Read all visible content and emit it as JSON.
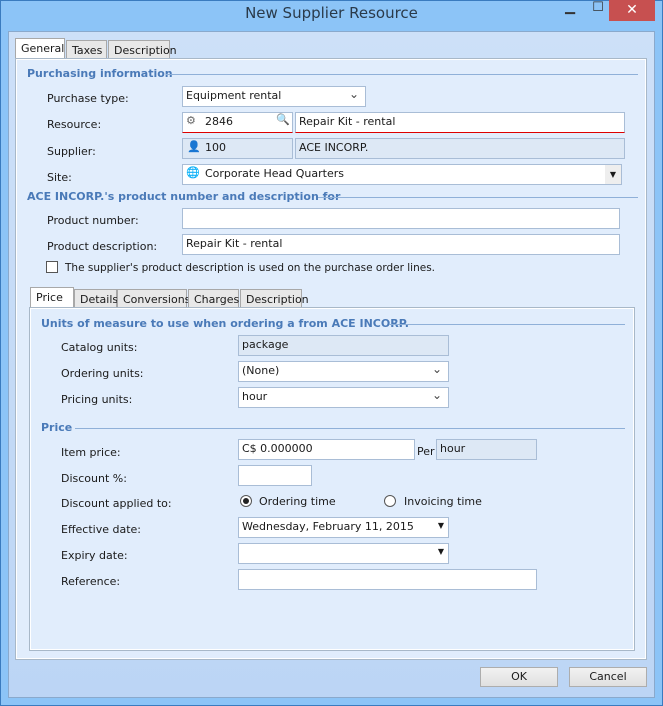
{
  "window": {
    "title": "New Supplier Resource"
  },
  "tabs": [
    "General",
    "Taxes",
    "Description"
  ],
  "purchasing": {
    "heading": "Purchasing information",
    "purchase_type_label": "Purchase type:",
    "purchase_type": "Equipment rental",
    "resource_label": "Resource:",
    "resource_id": "2846",
    "resource_name": "Repair Kit - rental",
    "supplier_label": "Supplier:",
    "supplier_id": "100",
    "supplier_name": "ACE INCORP.",
    "site_label": "Site:",
    "site": "Corporate Head Quarters"
  },
  "product": {
    "heading": "ACE INCORP.'s product number and description for",
    "number_label": "Product number:",
    "number": "",
    "description_label": "Product description:",
    "description": "Repair Kit - rental",
    "checkbox_label": "The supplier's product description is used on the purchase order lines."
  },
  "subtabs": [
    "Price",
    "Details",
    "Conversions",
    "Charges",
    "Description"
  ],
  "units": {
    "heading": "Units of measure to use when ordering a  from ACE INCORP.",
    "catalog_label": "Catalog units:",
    "catalog": "package",
    "ordering_label": "Ordering units:",
    "ordering": "(None)",
    "pricing_label": "Pricing units:",
    "pricing": "hour"
  },
  "price": {
    "heading": "Price",
    "item_price_label": "Item price:",
    "item_price": "C$ 0.000000",
    "per_label": "Per",
    "per_unit": "hour",
    "discount_label": "Discount %:",
    "discount": "",
    "applied_label": "Discount applied to:",
    "opt_ordering": "Ordering time",
    "opt_invoicing": "Invoicing time",
    "effective_label": "Effective date:",
    "effective": "Wednesday, February 11, 2015",
    "expiry_label": "Expiry date:",
    "expiry": "",
    "reference_label": "Reference:",
    "reference": ""
  },
  "buttons": {
    "ok": "OK",
    "cancel": "Cancel"
  }
}
